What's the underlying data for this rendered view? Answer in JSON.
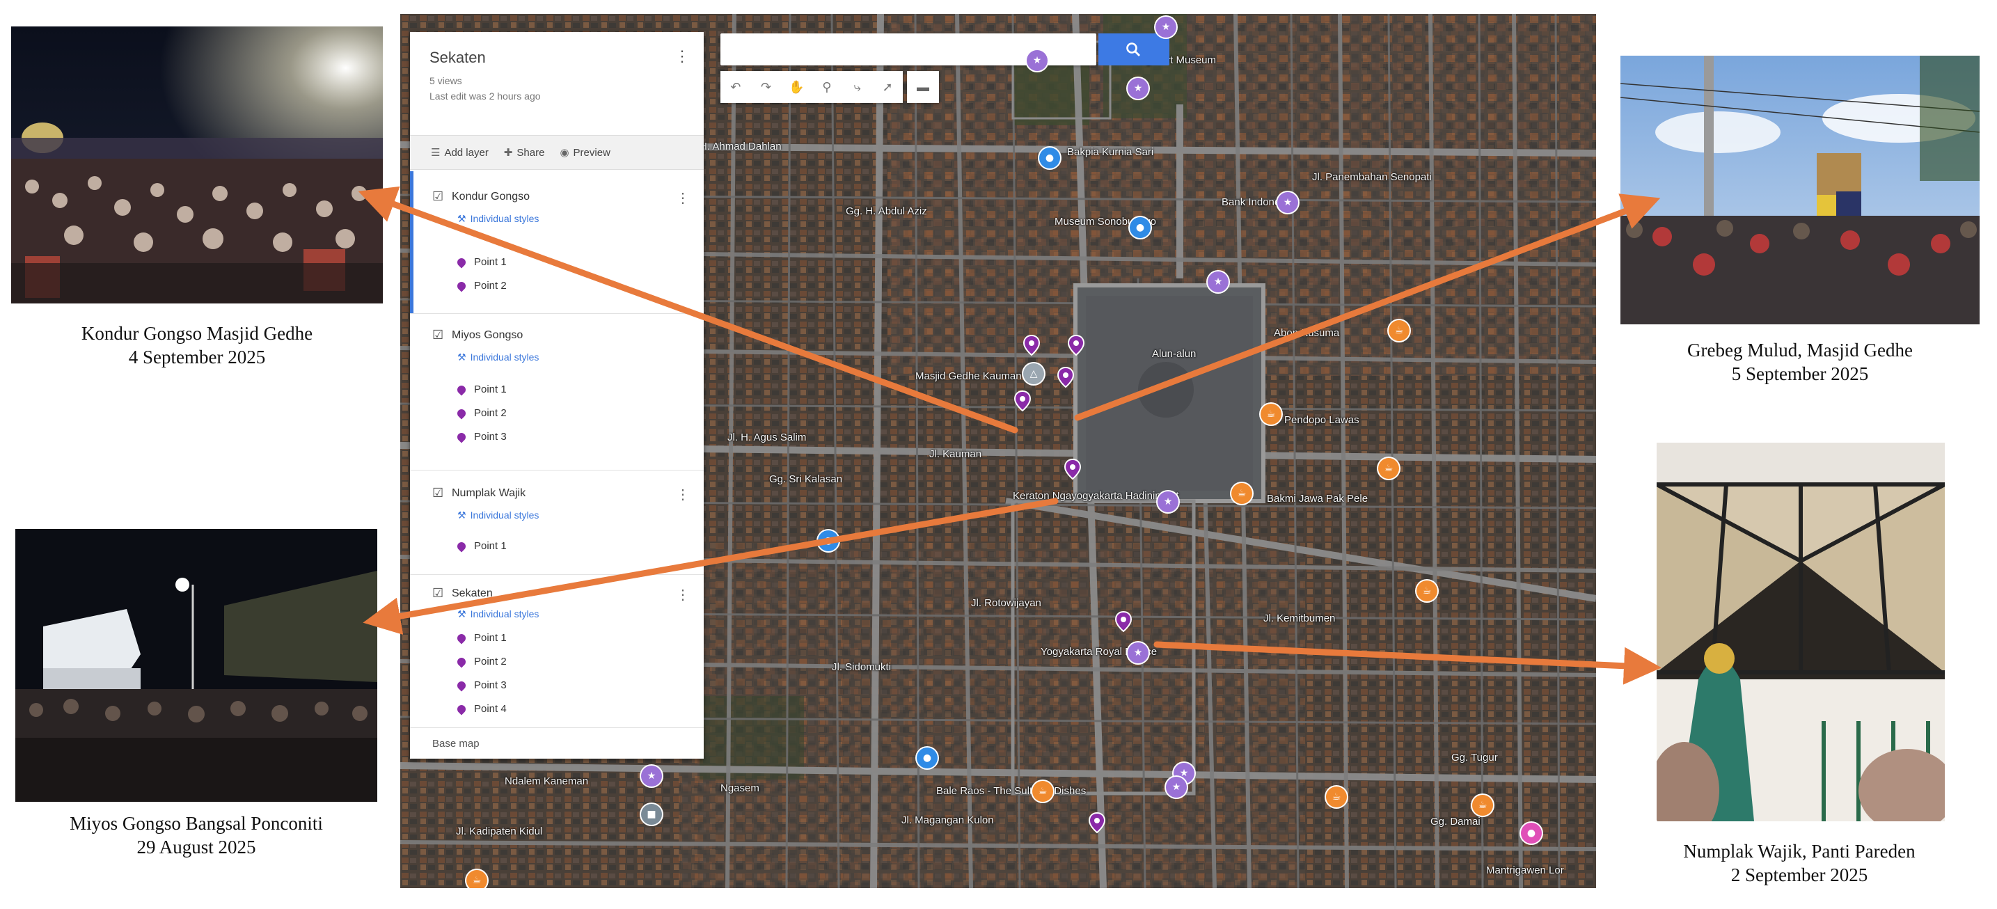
{
  "panel": {
    "title": "Sekaten",
    "views": "5 views",
    "last_edit": "Last edit was 2 hours ago",
    "actions": {
      "add_layer": "Add layer",
      "share": "Share",
      "preview": "Preview"
    },
    "layers": [
      {
        "name": "Kondur Gongso",
        "style": "Individual styles",
        "points": [
          "Point 1",
          "Point 2"
        ]
      },
      {
        "name": "Miyos Gongso",
        "style": "Individual styles",
        "points": [
          "Point 1",
          "Point 2",
          "Point 3"
        ]
      },
      {
        "name": "Numplak Wajik",
        "style": "Individual styles",
        "points": [
          "Point 1"
        ]
      },
      {
        "name": "Sekaten",
        "style": "Individual styles",
        "points": [
          "Point 1",
          "Point 2",
          "Point 3",
          "Point 4"
        ]
      }
    ],
    "base_map": "Base map"
  },
  "map_labels": {
    "kh_ahmad_dahlan": "KH. Ahmad Dahlan",
    "bakpia": "Bakpia Kurnia Sari",
    "museum_sono": "Museum Sonobudoyo",
    "jl_panembahan": "Jl. Panembahan Senopati",
    "bank": "Bank Indonesia",
    "gg_abdul_aziz": "Gg. H. Abdul Aziz",
    "alun": "Alun-alun",
    "abon": "Abon Kusuma",
    "masjid": "Masjid Gedhe Kauman",
    "jl_agus_salim": "Jl. H. Agus Salim",
    "jl_kauman": "Jl. Kauman",
    "pendopo": "Pendopo Lawas",
    "gg_kalasan": "Gg. Sri Kalasan",
    "keraton": "Keraton Ngayogyakarta Hadiningrat",
    "bakmi": "Bakmi Jawa Pak Pele",
    "jl_rotowijayan": "Jl. Rotowijayan",
    "kemitbumen": "Jl. Kemitbumen",
    "palace": "Yogyakarta Royal Palace",
    "jl_sidomukti": "Jl. Sidomukti",
    "bale_raos": "Bale Raos - The Sultan's Dishes",
    "jl_magangan": "Jl. Magangan Kulon",
    "ngasem": "Ngasem",
    "kadipaten": "Jl. Kadipaten Kidul",
    "mantrigawen": "Mantrigawen Lor",
    "gg_damai": "Gg. Damai",
    "gg_tugur": "Gg. Tugur",
    "ndalem": "Ndalem Kaneman",
    "fort_museum": "Vredeburg Fort Museum"
  },
  "photos": [
    {
      "id": "kondur",
      "caption_line1": "Kondur Gongso  Masjid Gedhe",
      "caption_line2": "4 September 2025"
    },
    {
      "id": "miyos",
      "caption_line1": "Miyos Gongso  Bangsal Ponconiti",
      "caption_line2": "29 August 2025"
    },
    {
      "id": "grebeg",
      "caption_line1": "Grebeg Mulud, Masjid Gedhe",
      "caption_line2": "5 September 2025"
    },
    {
      "id": "numplak",
      "caption_line1": "Numplak Wajik, Panti Pareden",
      "caption_line2": "2 September 2025"
    }
  ],
  "colors": {
    "arrow": "#e87a3c",
    "pin": "#8a2aa8",
    "poi_orange": "#f08a2e",
    "poi_purple": "#9a71d6",
    "poi_blue": "#2f8be6",
    "search_button": "#3d7ae4"
  },
  "icons": {
    "search": "search-icon",
    "more": "kebab-icon",
    "add_layer": "layers-icon",
    "share": "share-icon",
    "preview": "eye-icon",
    "checkbox": "checkbox-checked-icon",
    "style": "paint-roller-icon",
    "pin": "map-pin-icon"
  }
}
